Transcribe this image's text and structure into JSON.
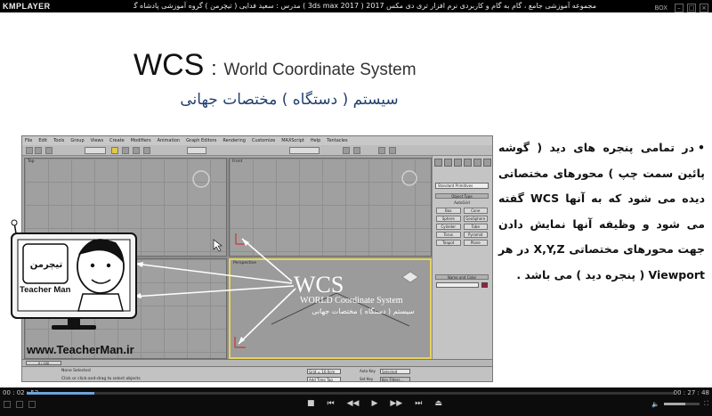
{
  "player": {
    "logo": "KMPLAYER",
    "title": "مجموعه آموزشی جامع ، گام به گام و کاربردی نرم افزار تری دی مکس 2017 ( 3ds max 2017 )   مدرس : سعید فدایی ( تیچرمن ) گروه آموزشی پادشاه گرافیست ها",
    "box_label": "BOX",
    "elapsed": "00 : 02 : 52",
    "total": "00 : 27 : 48",
    "progress": 0.104,
    "volume": 0.6
  },
  "slide": {
    "title_big": "WCS",
    "title_colon": ":",
    "title_small": "World Coordinate System",
    "subtitle": "سیستم ( دستگاه ) مختصات جهانی",
    "bullet": "•",
    "body": "در تمامی پنجره های دید ( گوشه پائین سمت چپ ) محورهای مختصاتی دیده می شود که به آنها WCS گفته می شود و وظیفه آنها نمایش دادن جهت محورهای مختصاتی X,Y,Z در هر Viewport ( پنجره دید ) می باشد ."
  },
  "overlay": {
    "big": "WCS",
    "sub": "WORLD Coordinate System",
    "fa": "سیستم ( دستگاه ) مختصات جهانی"
  },
  "max": {
    "menu": [
      "File",
      "Edit",
      "Tools",
      "Group",
      "Views",
      "Create",
      "Modifiers",
      "Animation",
      "Graph Editors",
      "Rendering",
      "Customize",
      "MAXScript",
      "Help",
      "Tentacles"
    ],
    "viewports": [
      "Top",
      "Front",
      "Left",
      "Perspective"
    ],
    "dropdown": "Standard Primitives",
    "object_type": "Object Type",
    "auto_grid": "AutoGrid",
    "buttons": [
      "Box",
      "Cone",
      "Sphere",
      "GeoSphere",
      "Cylinder",
      "Tube",
      "Torus",
      "Pyramid",
      "Teapot",
      "Plane"
    ],
    "name_color": "Name and Color",
    "status1": "None Selected",
    "status2": "Click or click-and-drag to select objects",
    "frame": "0 / 100",
    "grid": "Grid = 10.0cm",
    "autokey": "Auto Key",
    "setkey": "Set Key",
    "selected": "Selected",
    "keyfilters": "Key Filters...",
    "addtime": "Add Time Tag"
  },
  "brand": {
    "logo_fa": "تیچرمن",
    "name": "Teacher Man",
    "site": "www.TeacherMan.ir"
  },
  "colors": {
    "subtitle": "#223f6e",
    "seek": "#6fa3d9",
    "active_viewport": "#e6d35a"
  }
}
